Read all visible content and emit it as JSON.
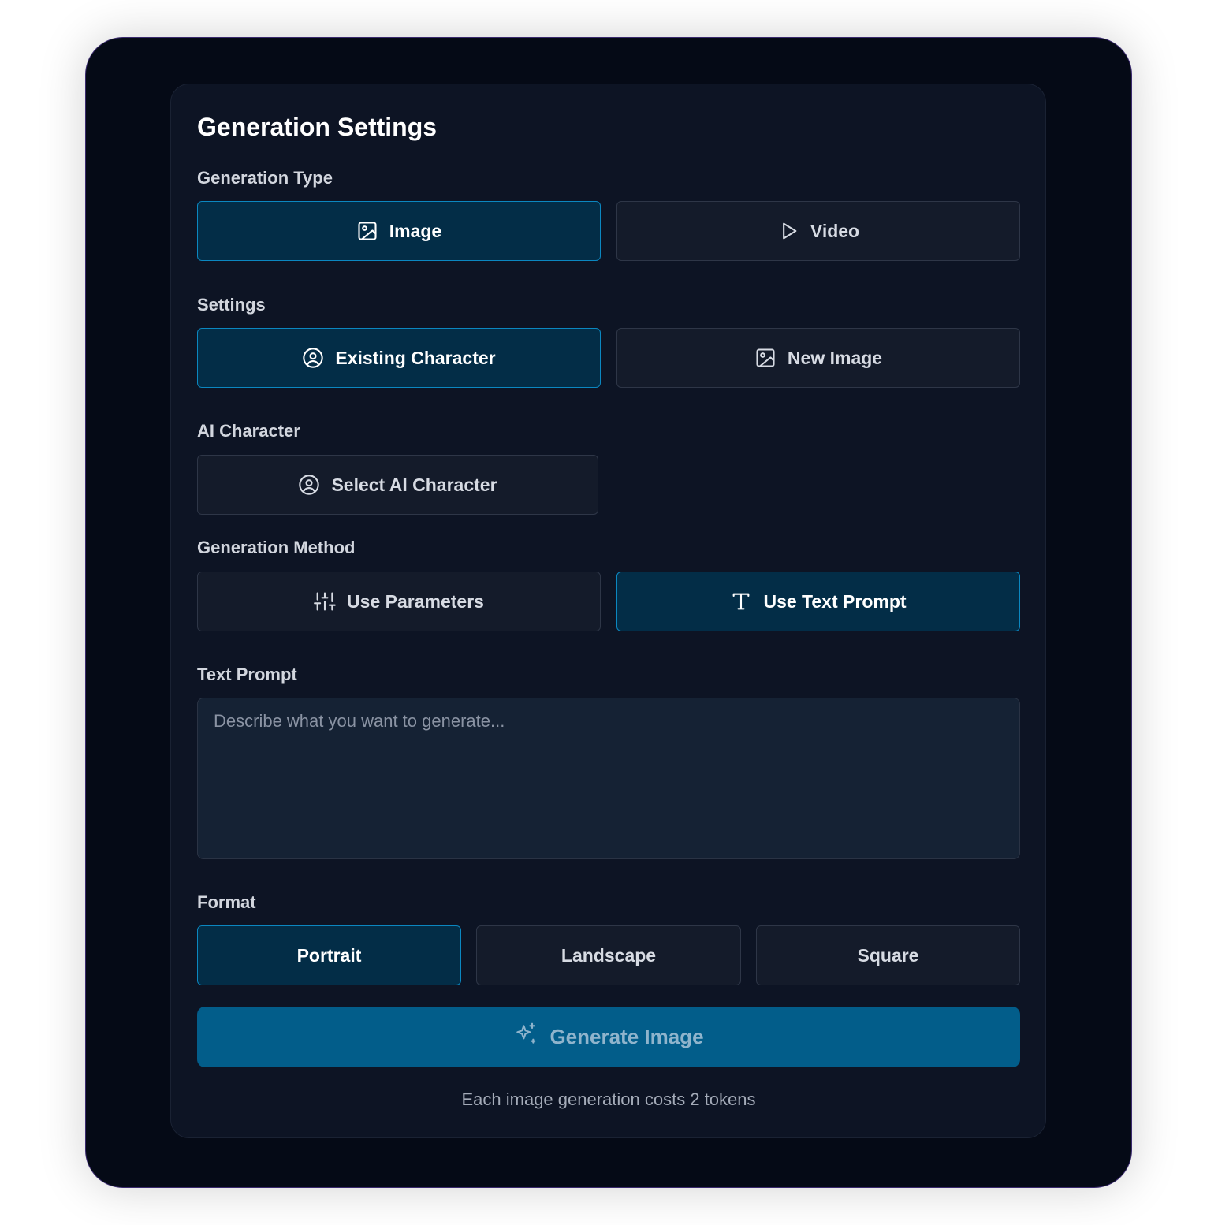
{
  "title": "Generation Settings",
  "sections": {
    "generation_type": {
      "label": "Generation Type",
      "options": [
        {
          "label": "Image",
          "icon": "image-icon",
          "selected": true
        },
        {
          "label": "Video",
          "icon": "play-icon",
          "selected": false
        }
      ]
    },
    "settings": {
      "label": "Settings",
      "options": [
        {
          "label": "Existing Character",
          "icon": "user-circle-icon",
          "selected": true
        },
        {
          "label": "New Image",
          "icon": "image-icon",
          "selected": false
        }
      ]
    },
    "ai_character": {
      "label": "AI Character",
      "button": {
        "label": "Select AI Character",
        "icon": "user-circle-icon"
      }
    },
    "generation_method": {
      "label": "Generation Method",
      "options": [
        {
          "label": "Use Parameters",
          "icon": "sliders-icon",
          "selected": false
        },
        {
          "label": "Use Text Prompt",
          "icon": "text-icon",
          "selected": true
        }
      ]
    },
    "text_prompt": {
      "label": "Text Prompt",
      "value": "",
      "placeholder": "Describe what you want to generate..."
    },
    "format": {
      "label": "Format",
      "options": [
        {
          "label": "Portrait",
          "selected": true
        },
        {
          "label": "Landscape",
          "selected": false
        },
        {
          "label": "Square",
          "selected": false
        }
      ]
    }
  },
  "generate_button": {
    "label": "Generate Image",
    "icon": "sparkles-icon"
  },
  "cost_note": "Each image generation costs 2 tokens",
  "colors": {
    "background": "#050a16",
    "panel": "#0d1424",
    "option": "#141b2a",
    "selected": "#032d47",
    "selected_border": "#0b87c0",
    "primary_button": "#025d8a"
  }
}
